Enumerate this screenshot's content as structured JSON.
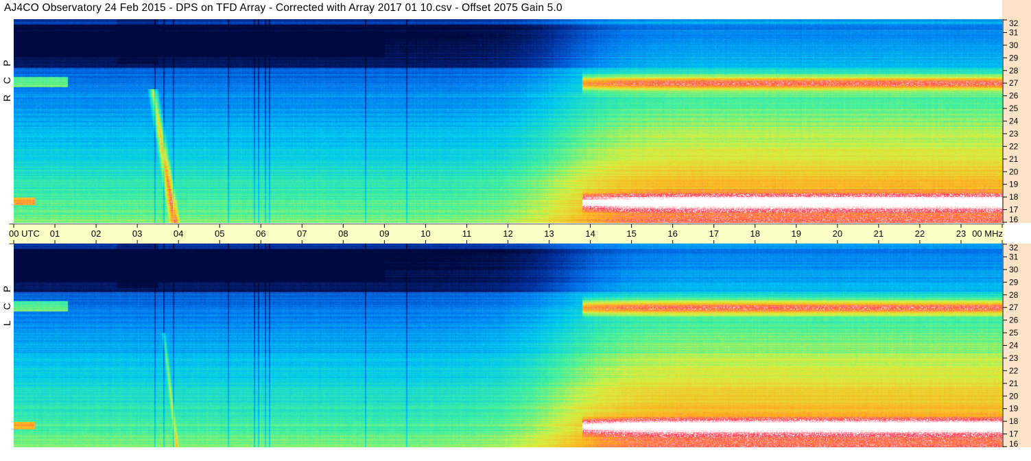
{
  "title": "AJ4CO Observatory  24 Feb 2015  -  DPS on TFD Array  -  Corrected with Array 2017 01 10.csv  -  Offset 2075  Gain 5.0",
  "panels": [
    {
      "label": [
        "R",
        "C",
        "P"
      ]
    },
    {
      "label": [
        "L",
        "C",
        "P"
      ]
    }
  ],
  "chart_data": {
    "type": "heatmap",
    "title": "AJ4CO Observatory  24 Feb 2015  -  DPS on TFD Array  -  Corrected with Array 2017 01 10.csv  -  Offset 2075  Gain 5.0",
    "x_axis": {
      "range": [
        0,
        24
      ],
      "tick_labels": [
        "00 UTC",
        "01",
        "02",
        "03",
        "04",
        "05",
        "06",
        "07",
        "08",
        "09",
        "10",
        "11",
        "12",
        "13",
        "14",
        "15",
        "16",
        "17",
        "18",
        "19",
        "20",
        "21",
        "22",
        "23",
        "00 MHz"
      ]
    },
    "y_axis": {
      "unit": "MHz",
      "range": [
        16,
        32
      ],
      "tick_labels": [
        "16",
        "17",
        "18",
        "19",
        "20",
        "21",
        "22",
        "23",
        "24",
        "25",
        "26",
        "27",
        "28",
        "29",
        "30",
        "31",
        "32"
      ]
    },
    "colormap": [
      "#000a40",
      "#0032a0",
      "#0078f0",
      "#00c8f0",
      "#40f0a0",
      "#d8f040",
      "#ffb020",
      "#ff4060",
      "#ffffff"
    ],
    "series": [
      {
        "name": "R C P"
      },
      {
        "name": "L C P"
      }
    ]
  }
}
